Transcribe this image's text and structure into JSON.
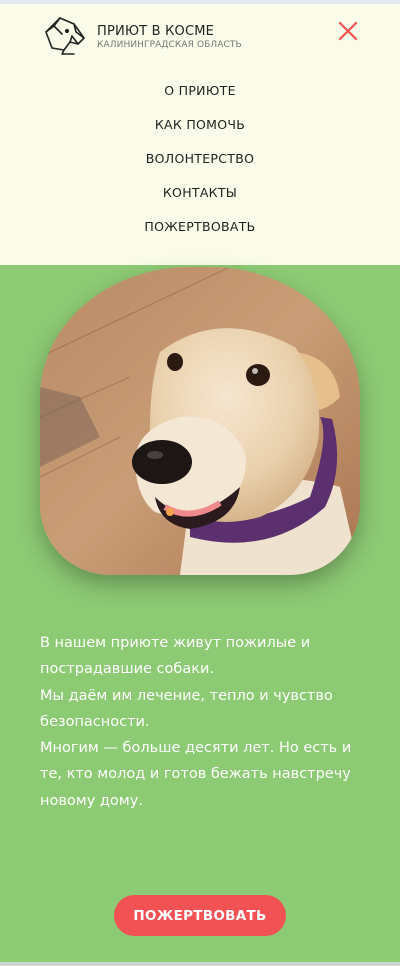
{
  "header": {
    "brand_title": "ПРИЮТ В КОСМЕ",
    "brand_subtitle": "КАЛИНИНГРАДСКАЯ ОБЛАСТЬ",
    "logo_icon": "dog-head-icon",
    "close_icon": "close-icon"
  },
  "nav": {
    "items": [
      {
        "label": "О ПРИЮТЕ"
      },
      {
        "label": "КАК ПОМОЧЬ"
      },
      {
        "label": "ВОЛОНТЕРСТВО"
      },
      {
        "label": "КОНТАКТЫ"
      },
      {
        "label": "ПОЖЕРТВОВАТЬ"
      }
    ]
  },
  "hero": {
    "photo": "smiling-dog-photo",
    "paragraphs": [
      "В нашем приюте живут пожилые и пострадавшие собаки.",
      "Мы даём им лечение, тепло и чувство безопасности.",
      "Многим — больше десяти лет. Но есть и те, кто молод и готов бежать навстречу новому дому."
    ],
    "donate_label": "ПОЖЕРТВОВАТЬ"
  },
  "colors": {
    "header_bg": "#fafbe9",
    "page_bg": "#8dca74",
    "accent": "#f25253",
    "text_dark": "#222222"
  }
}
